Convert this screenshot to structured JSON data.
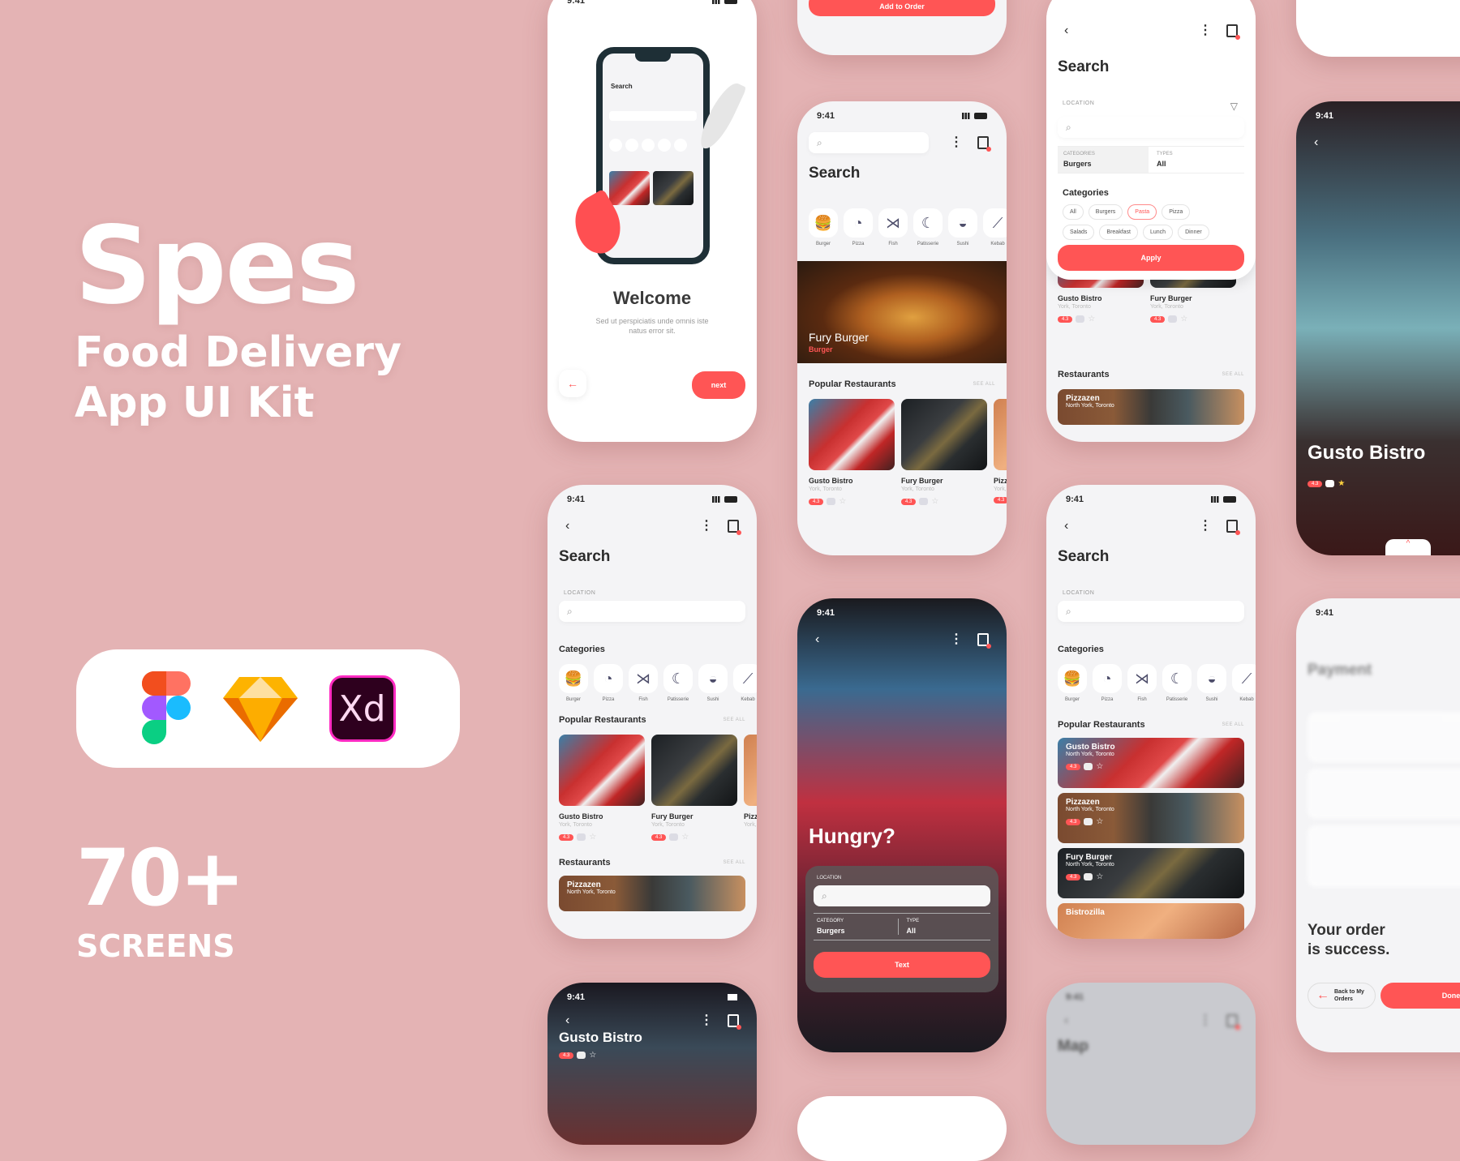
{
  "hero": {
    "brand": "Spes",
    "subtitle_line1": "Food Delivery",
    "subtitle_line2": "App UI Kit",
    "count": "70+",
    "count_label": "SCREENS",
    "tools": [
      "figma-icon",
      "sketch-icon",
      "adobe-xd-icon"
    ],
    "xd_label": "Xd"
  },
  "colors": {
    "background": "#e4b3b4",
    "accent": "#ff5555",
    "text": "#2b2b2b"
  },
  "status_time": "9:41",
  "common": {
    "search_title": "Search",
    "location_label": "LOCATION",
    "categories_title": "Categories",
    "popular_title": "Popular Restaurants",
    "restaurants_title": "Restaurants",
    "see_all": "SEE ALL",
    "rating": "4.3",
    "categories": [
      "Burger",
      "Pizza",
      "Fish",
      "Patisserie",
      "Sushi",
      "Kebab"
    ],
    "popular": [
      {
        "name": "Gusto Bistro",
        "location": "York, Toronto"
      },
      {
        "name": "Fury Burger",
        "location": "York, Toronto"
      },
      {
        "name": "Pizzazen",
        "location": "York, Toronto"
      }
    ]
  },
  "welcome": {
    "title": "Welcome",
    "text": "Sed ut perspiciatis unde omnis iste natus error sit.",
    "next": "next"
  },
  "add_to_order": {
    "button": "Add to Order"
  },
  "home": {
    "featured_name": "Fury Burger",
    "featured_category": "Burger"
  },
  "filter": {
    "categories_label": "CATEGORIES",
    "categories_value": "Burgers",
    "types_label": "TYPES",
    "types_value": "All",
    "chips": [
      "All",
      "Burgers",
      "Pasta",
      "Pizza",
      "Salads",
      "Breakfast",
      "Lunch",
      "Dinner"
    ],
    "selected_chip": "Pasta",
    "apply": "Apply",
    "restaurant_name": "Pizzazen",
    "restaurant_location": "North York, Toronto"
  },
  "detail": {
    "name": "Gusto Bistro",
    "rating": "4.3"
  },
  "search_list": {
    "restaurant_name": "Pizzazen",
    "restaurant_location": "North York, Toronto"
  },
  "hungry": {
    "title": "Hungry?",
    "location_label": "LOCATION",
    "category_label": "CATEGORY",
    "category_value": "Burgers",
    "type_label": "TYPE",
    "type_value": "All",
    "button": "Text"
  },
  "list_view": {
    "items": [
      {
        "name": "Gusto Bistro",
        "location": "North York, Toronto"
      },
      {
        "name": "Pizzazen",
        "location": "North York, Toronto"
      },
      {
        "name": "Fury Burger",
        "location": "North York, Toronto"
      },
      {
        "name": "Bistrozilla",
        "location": ""
      }
    ]
  },
  "payment": {
    "title": "Payment",
    "success_line1": "Your order",
    "success_line2": "is success.",
    "back": "Back to My Orders",
    "done": "Done"
  },
  "map": {
    "title": "Map"
  }
}
